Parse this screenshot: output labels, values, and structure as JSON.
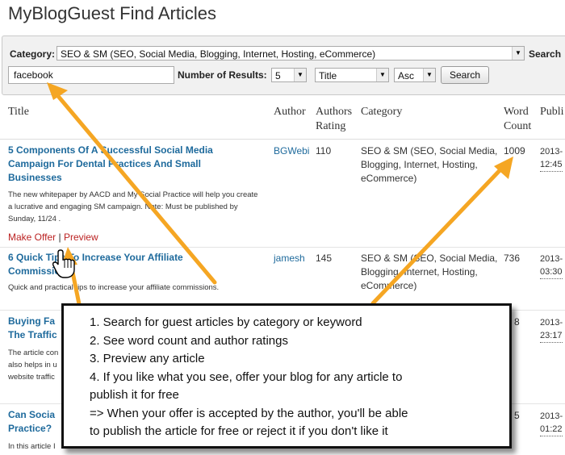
{
  "page": {
    "title": "MyBlogGuest Find Articles"
  },
  "filters": {
    "category_label": "Category:",
    "category_value": "SEO & SM (SEO, Social Media, Blogging, Internet, Hosting, eCommerce)",
    "search_label": "Search",
    "keyword_value": "facebook",
    "results_label": "Number of Results:",
    "results_value": "5",
    "sort_value": "Title",
    "order_value": "Asc",
    "search_button": "Search"
  },
  "table": {
    "headers": {
      "title": "Title",
      "author": "Author",
      "authors_rating": [
        "Authors",
        "Rating"
      ],
      "category": "Category",
      "word_count": [
        "Word",
        "Count"
      ],
      "published": "Publi"
    },
    "rows": [
      {
        "title_lines": [
          "5 Components Of A Successful Social Media",
          "Campaign For Dental Practices And Small",
          "Businesses"
        ],
        "desc_lines": [
          "The new whitepaper by AACD and My Social Practice will help you create",
          "a lucrative and engaging SM campaign. Note: Must be published by",
          "Sunday, 11/24 ."
        ],
        "author": "BGWebi",
        "rating": "110",
        "category_lines": [
          "SEO & SM (SEO, Social Media,",
          "Blogging, Internet, Hosting,",
          "eCommerce)"
        ],
        "word_count": "1009",
        "pub_lines": [
          "2013-",
          "12:45"
        ],
        "actions": {
          "offer": "Make Offer",
          "separator": "|",
          "preview": "Preview"
        }
      },
      {
        "title_lines": [
          "6 Quick Tips To Increase Your Affiliate",
          "Commissions"
        ],
        "desc_lines": [
          "Quick and practical tips to increase your affiliate commissions."
        ],
        "author": "jamesh",
        "rating": "145",
        "category_lines": [
          "SEO & SM (SEO, Social Media,",
          "Blogging, Internet, Hosting,",
          "eCommerce)"
        ],
        "word_count": "736",
        "pub_lines": [
          "2013-",
          "03:30"
        ]
      },
      {
        "title_lines": [
          "Buying Fa",
          "The Traffic"
        ],
        "desc_lines": [
          "The article con",
          "also helps in u",
          "website traffic"
        ],
        "word_count": "8",
        "pub_lines": [
          "2013-",
          "23:17"
        ]
      },
      {
        "title_lines": [
          "Can Socia",
          "Practice?"
        ],
        "desc_lines": [
          "In this article I"
        ],
        "word_count": "5",
        "pub_lines": [
          "2013-",
          "01:22"
        ]
      }
    ]
  },
  "callout": {
    "lines": [
      "1. Search for guest articles by category or keyword",
      "2. See word count and author ratings",
      "3. Preview any article",
      "4. If you like what you see, offer your blog for any article to",
      "publish it for free",
      "=> When your offer is accepted by the author, you'll be able",
      "to publish the article for free or reject it if you don't like it"
    ]
  },
  "colors": {
    "link": "#1e6a9c",
    "action": "#b22222",
    "arrow": "#f5a623",
    "callout_border": "#111111"
  }
}
